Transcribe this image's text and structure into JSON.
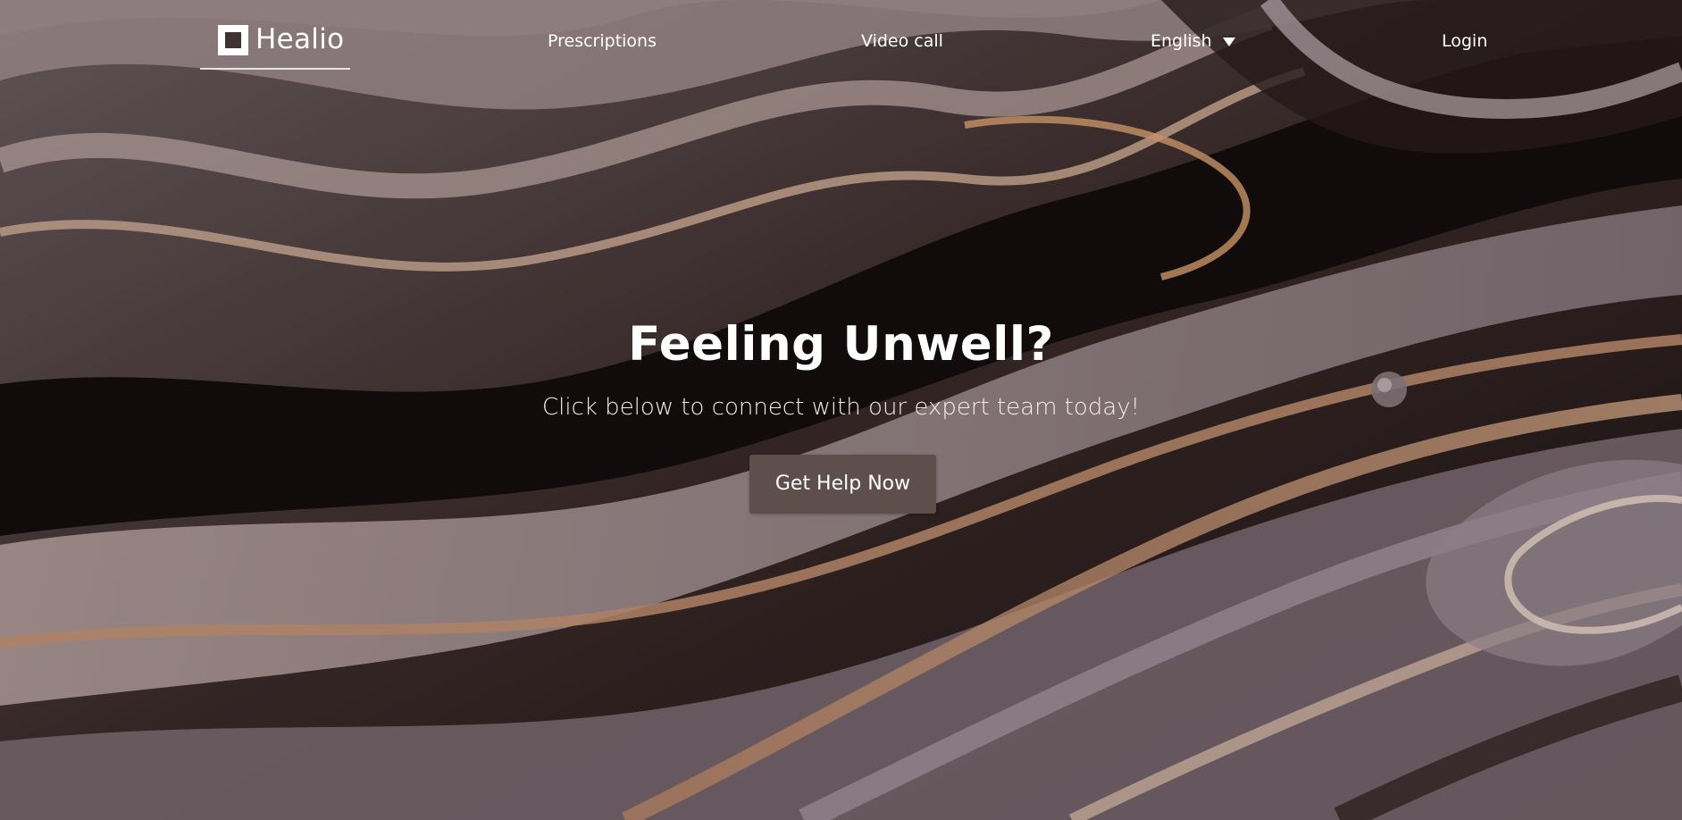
{
  "brand": {
    "name": "Healio",
    "logo_icon": "square-logo-icon"
  },
  "nav": {
    "prescriptions": "Prescriptions",
    "video_call": "Video call",
    "language": "English",
    "language_icon": "caret-down-icon",
    "login": "Login"
  },
  "hero": {
    "headline": "Feeling Unwell?",
    "subline": "Click below to connect with our expert team today!",
    "cta_label": "Get Help Now"
  },
  "colors": {
    "cta_background": "#5e4f4d",
    "text": "#ffffff"
  }
}
